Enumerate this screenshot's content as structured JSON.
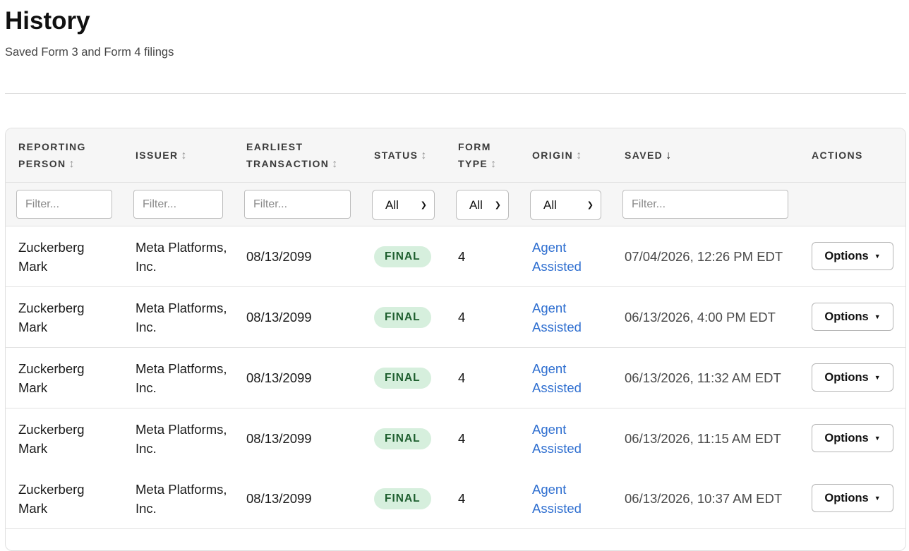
{
  "page": {
    "title": "History",
    "subtitle": "Saved Form 3 and Form 4 filings"
  },
  "table": {
    "columns": [
      {
        "label": "REPORTING PERSON",
        "sort": "↕"
      },
      {
        "label": "ISSUER",
        "sort": "↕"
      },
      {
        "label": "EARLIEST TRANSACTION",
        "sort": "↕"
      },
      {
        "label": "STATUS",
        "sort": "↕"
      },
      {
        "label": "FORM TYPE",
        "sort": "↕"
      },
      {
        "label": "ORIGIN",
        "sort": "↕"
      },
      {
        "label": "SAVED",
        "sort": "↓"
      },
      {
        "label": "ACTIONS",
        "sort": ""
      }
    ],
    "filters": {
      "reporting_person_placeholder": "Filter...",
      "issuer_placeholder": "Filter...",
      "earliest_transaction_placeholder": "Filter...",
      "status_value": "All",
      "form_type_value": "All",
      "origin_value": "All",
      "saved_placeholder": "Filter..."
    },
    "options_label": "Options",
    "rows": [
      {
        "person": "Zuckerberg Mark",
        "issuer": "Meta Platforms, Inc.",
        "earliest": "08/13/2099",
        "status": "FINAL",
        "form_type": "4",
        "origin": "Agent Assisted",
        "saved": "07/04/2026, 12:26 PM EDT"
      },
      {
        "person": "Zuckerberg Mark",
        "issuer": "Meta Platforms, Inc.",
        "earliest": "08/13/2099",
        "status": "FINAL",
        "form_type": "4",
        "origin": "Agent Assisted",
        "saved": "06/13/2026, 4:00 PM EDT"
      },
      {
        "person": "Zuckerberg Mark",
        "issuer": "Meta Platforms, Inc.",
        "earliest": "08/13/2099",
        "status": "FINAL",
        "form_type": "4",
        "origin": "Agent Assisted",
        "saved": "06/13/2026, 11:32 AM EDT"
      },
      {
        "person": "Zuckerberg Mark",
        "issuer": "Meta Platforms, Inc.",
        "earliest": "08/13/2099",
        "status": "FINAL",
        "form_type": "4",
        "origin": "Agent Assisted",
        "saved": "06/13/2026, 11:15 AM EDT"
      },
      {
        "person": "Zuckerberg Mark",
        "issuer": "Meta Platforms, Inc.",
        "earliest": "08/13/2099",
        "status": "FINAL",
        "form_type": "4",
        "origin": "Agent Assisted",
        "saved": "06/13/2026, 10:37 AM EDT"
      }
    ]
  },
  "colors": {
    "status_final_bg": "#d6efdd",
    "status_final_text": "#1d5e2e",
    "link": "#2f6fd0"
  },
  "icons": {
    "sort": "sort-arrows-icon",
    "sort_active": "sort-descending-icon",
    "select": "chevron-down-icon",
    "options": "caret-down-icon"
  }
}
